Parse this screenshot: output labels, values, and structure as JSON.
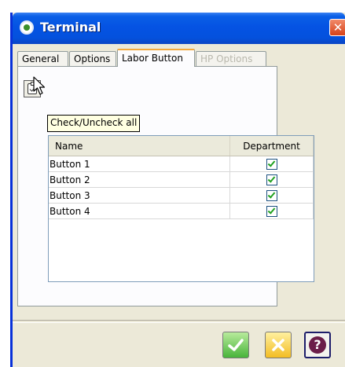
{
  "window": {
    "title": "Terminal",
    "close_glyph": "✕"
  },
  "tabs": [
    {
      "label": "General",
      "active": false,
      "disabled": false
    },
    {
      "label": "Options",
      "active": false,
      "disabled": false
    },
    {
      "label": "Labor Button",
      "active": true,
      "disabled": false
    },
    {
      "label": "HP Options",
      "active": false,
      "disabled": true
    }
  ],
  "toolbar": {
    "check_all_icon": "clipboard-check-icon",
    "tooltip": "Check/Uncheck all"
  },
  "grid": {
    "columns": [
      "Name",
      "Department"
    ],
    "rows": [
      {
        "name": "Button 1",
        "department": true
      },
      {
        "name": "Button 2",
        "department": true
      },
      {
        "name": "Button 3",
        "department": true
      },
      {
        "name": "Button 4",
        "department": true
      }
    ]
  },
  "footer": {
    "ok_icon": "check-icon",
    "cancel_icon": "x-icon",
    "help_icon": "question-icon",
    "help_glyph": "?"
  },
  "colors": {
    "title_bar": "#0553e3",
    "active_tab_accent": "#f4a93b",
    "ok": "#48b43a",
    "cancel": "#f3bd23",
    "help": "#6b1d49"
  }
}
